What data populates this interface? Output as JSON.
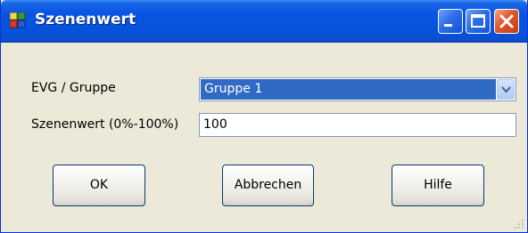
{
  "window": {
    "title": "Szenenwert"
  },
  "form": {
    "evg_label": "EVG / Gruppe",
    "evg_value": "Gruppe 1",
    "szenenwert_label": "Szenenwert (0%-100%)",
    "szenenwert_value": "100"
  },
  "buttons": {
    "ok": "OK",
    "abbrechen": "Abbrechen",
    "hilfe": "Hilfe"
  },
  "icons": {
    "app": "app-icon",
    "minimize": "minimize-icon",
    "maximize": "maximize-icon",
    "close": "close-icon",
    "dropdown": "chevron-down-icon",
    "resize": "resize-grip-icon"
  }
}
